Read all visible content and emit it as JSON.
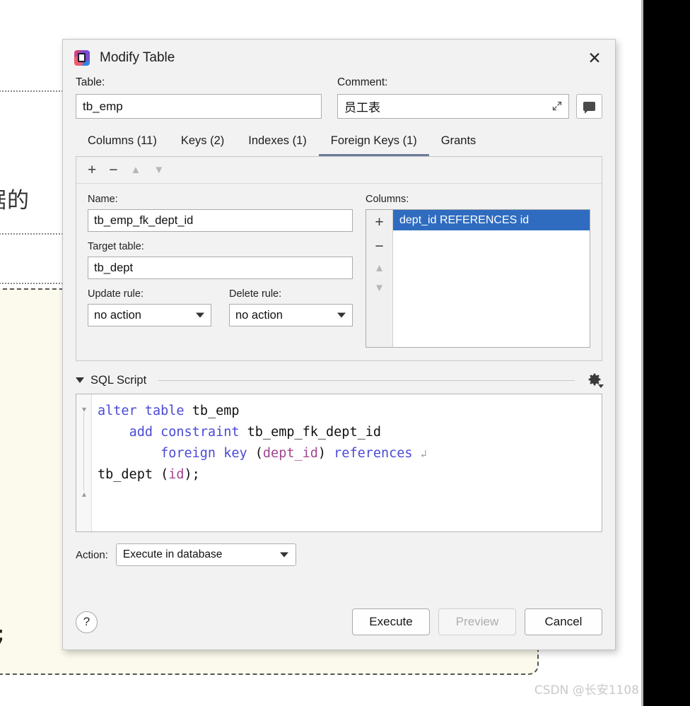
{
  "background": {
    "text_fragment": "据的",
    "code_fragment": ";",
    "watermark": "CSDN @长安1108"
  },
  "dialog": {
    "title": "Modify Table",
    "app_icon": "datagrip-icon",
    "close_icon": "close-icon",
    "table": {
      "label": "Table:",
      "value": "tb_emp"
    },
    "comment": {
      "label": "Comment:",
      "value": "员工表",
      "expand_icon": "expand-icon",
      "comment_button_icon": "comment-bubble-icon"
    },
    "tabs": [
      {
        "label": "Columns (11)",
        "active": false
      },
      {
        "label": "Keys (2)",
        "active": false
      },
      {
        "label": "Indexes (1)",
        "active": false
      },
      {
        "label": "Foreign Keys (1)",
        "active": true
      },
      {
        "label": "Grants",
        "active": false
      }
    ],
    "fk_toolbar": [
      {
        "icon": "plus-icon",
        "glyph": "+",
        "enabled": true
      },
      {
        "icon": "minus-icon",
        "glyph": "−",
        "enabled": true
      },
      {
        "icon": "move-up-icon",
        "glyph": "▲",
        "enabled": false
      },
      {
        "icon": "move-down-icon",
        "glyph": "▼",
        "enabled": false
      }
    ],
    "fk_form": {
      "name_label": "Name:",
      "name_value": "tb_emp_fk_dept_id",
      "target_label": "Target table:",
      "target_value": "tb_dept",
      "update_rule_label": "Update rule:",
      "update_rule_value": "no action",
      "delete_rule_label": "Delete rule:",
      "delete_rule_value": "no action"
    },
    "columns_panel": {
      "label": "Columns:",
      "buttons": [
        {
          "icon": "plus-icon",
          "glyph": "+",
          "enabled": true
        },
        {
          "icon": "minus-icon",
          "glyph": "−",
          "enabled": true
        },
        {
          "icon": "move-up-icon",
          "glyph": "▲",
          "enabled": false
        },
        {
          "icon": "move-down-icon",
          "glyph": "▼",
          "enabled": false
        }
      ],
      "items": [
        {
          "text": "dept_id REFERENCES id",
          "selected": true
        }
      ]
    },
    "sql_script": {
      "title": "SQL Script",
      "collapse_icon": "chevron-down-icon",
      "settings_icon": "gear-icon",
      "lines": [
        {
          "indent": 0,
          "tokens": [
            {
              "t": "alter",
              "c": "kw"
            },
            {
              "t": " ",
              "c": "id"
            },
            {
              "t": "table",
              "c": "kw"
            },
            {
              "t": " ",
              "c": "id"
            },
            {
              "t": "tb_emp",
              "c": "id"
            }
          ]
        },
        {
          "indent": 4,
          "tokens": [
            {
              "t": "add",
              "c": "kw"
            },
            {
              "t": " ",
              "c": "id"
            },
            {
              "t": "constraint",
              "c": "kw"
            },
            {
              "t": " ",
              "c": "id"
            },
            {
              "t": "tb_emp_fk_dept_id",
              "c": "id"
            }
          ]
        },
        {
          "indent": 8,
          "tokens": [
            {
              "t": "foreign",
              "c": "kw"
            },
            {
              "t": " ",
              "c": "id"
            },
            {
              "t": "key",
              "c": "kw"
            },
            {
              "t": " (",
              "c": "id"
            },
            {
              "t": "dept_id",
              "c": "col"
            },
            {
              "t": ") ",
              "c": "id"
            },
            {
              "t": "references",
              "c": "kw"
            },
            {
              "t": " ",
              "c": "id"
            },
            {
              "t": "↲",
              "c": "wrapmark"
            }
          ]
        },
        {
          "indent": 0,
          "tokens": [
            {
              "t": "tb_dept",
              "c": "id"
            },
            {
              "t": " (",
              "c": "id"
            },
            {
              "t": "id",
              "c": "col"
            },
            {
              "t": ");",
              "c": "id"
            }
          ]
        }
      ]
    },
    "action": {
      "label": "Action:",
      "value": "Execute in database"
    },
    "footer": {
      "help_label": "?",
      "buttons": [
        {
          "label": "Execute",
          "enabled": true
        },
        {
          "label": "Preview",
          "enabled": false
        },
        {
          "label": "Cancel",
          "enabled": true
        }
      ]
    }
  },
  "colors": {
    "selection_blue": "#2f6cc0",
    "tab_underline": "#6b7a99",
    "keyword": "#4a4ad6",
    "column": "#a3448f",
    "dialog_bg": "#f2f2f2",
    "code_block_bg": "#fbfaec"
  }
}
